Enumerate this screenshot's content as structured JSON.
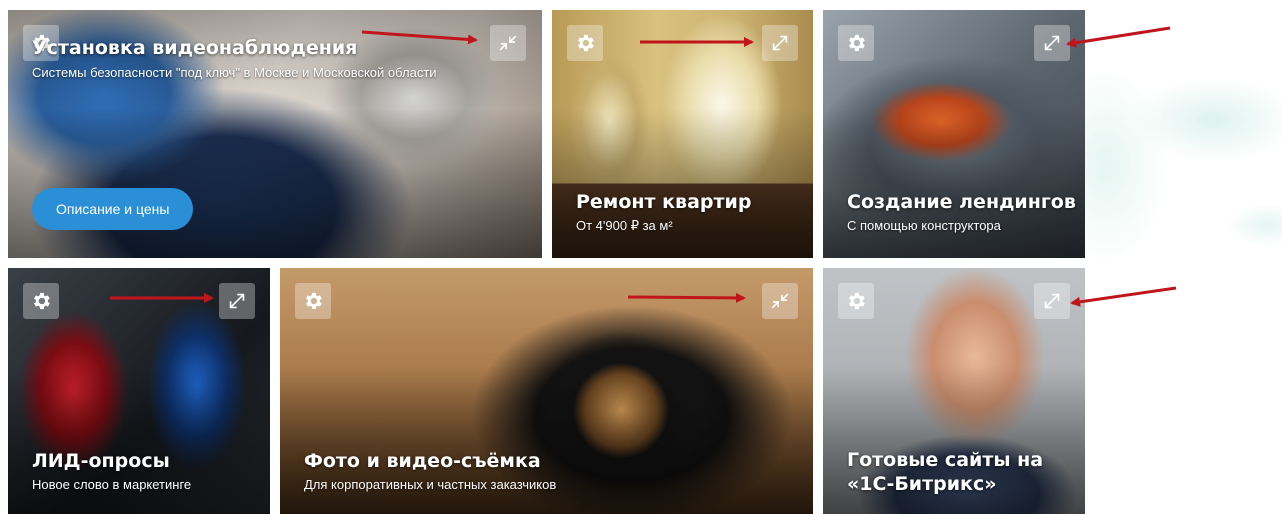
{
  "tiles": [
    {
      "title": "Установка видеонаблюдения",
      "subtitle": "Системы безопасности \"под ключ\" в Москве и Московской области",
      "button_label": "Описание и цены",
      "settings_icon": "gear-icon",
      "resize_icon": "collapse-icon"
    },
    {
      "title": "Ремонт квартир",
      "subtitle": "От 4'900 ₽ за м²",
      "settings_icon": "gear-icon",
      "resize_icon": "expand-icon"
    },
    {
      "title": "Создание лендингов",
      "subtitle": "С помощью конструктора",
      "settings_icon": "gear-icon",
      "resize_icon": "expand-icon"
    },
    {
      "title": "ЛИД-опросы",
      "subtitle": "Новое слово в маркетинге",
      "settings_icon": "gear-icon",
      "resize_icon": "expand-icon"
    },
    {
      "title": "Фото и видео-съёмка",
      "subtitle": "Для корпоративных и частных заказчиков",
      "settings_icon": "gear-icon",
      "resize_icon": "collapse-icon"
    },
    {
      "title_line1": "Готовые сайты на",
      "title_line2": "«1С-Битрикс»",
      "settings_icon": "gear-icon",
      "resize_icon": "expand-icon"
    }
  ],
  "colors": {
    "annotation_arrow": "#c0151b",
    "cta_button": "#2b8fd8",
    "control_bg": "rgba(255,255,255,0.32)"
  }
}
